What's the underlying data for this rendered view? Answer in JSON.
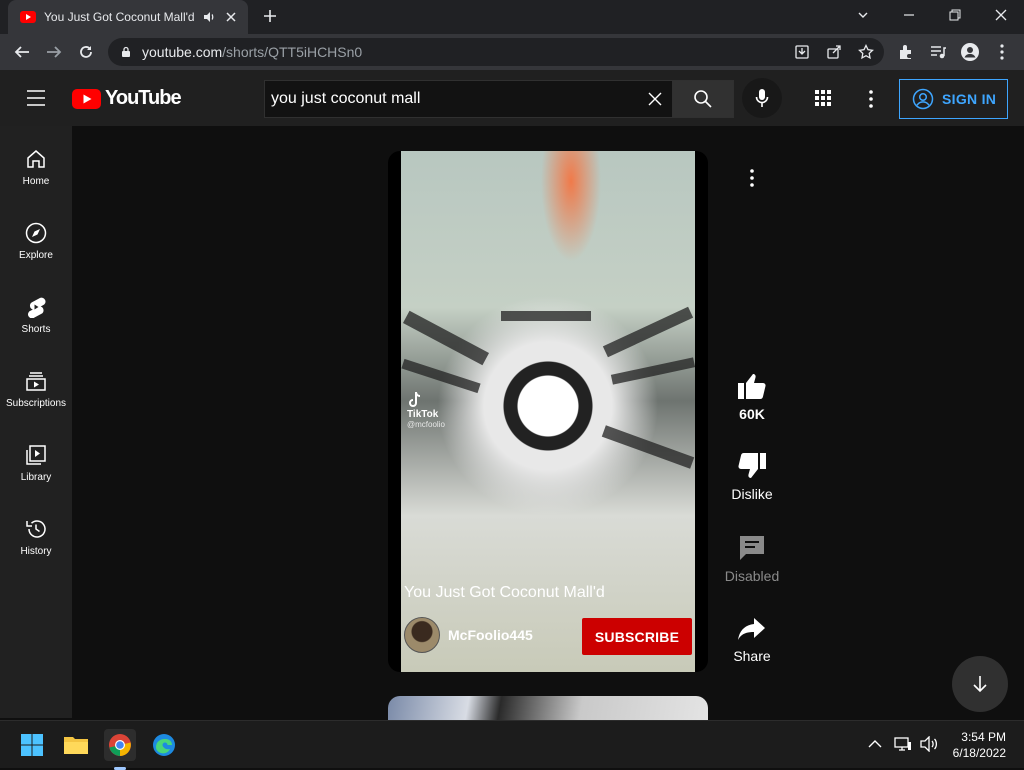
{
  "browser": {
    "tab_title": "You Just Got Coconut Mall'd",
    "url_host": "youtube.com",
    "url_path": "/shorts/QTT5iHCHSn0"
  },
  "youtube": {
    "logo_text": "YouTube",
    "search_value": "you just coconut mall",
    "sign_in_label": "SIGN IN"
  },
  "sidebar": {
    "items": [
      {
        "label": "Home",
        "icon": "home-icon"
      },
      {
        "label": "Explore",
        "icon": "compass-icon"
      },
      {
        "label": "Shorts",
        "icon": "shorts-icon"
      },
      {
        "label": "Subscriptions",
        "icon": "subscriptions-icon"
      },
      {
        "label": "Library",
        "icon": "library-icon"
      },
      {
        "label": "History",
        "icon": "history-icon"
      }
    ]
  },
  "short": {
    "title": "You Just Got Coconut Mall'd",
    "channel": "McFoolio445",
    "subscribe_label": "SUBSCRIBE",
    "overlay_watermark": "TikTok",
    "overlay_handle": "@mcfoolio"
  },
  "actions": {
    "likes": "60K",
    "dislike_label": "Dislike",
    "comments_label": "Disabled",
    "share_label": "Share"
  },
  "taskbar": {
    "time": "3:54 PM",
    "date": "6/18/2022"
  },
  "colors": {
    "yt_red": "#ff0000",
    "subscribe_red": "#cc0000",
    "sign_in_blue": "#3ea6ff"
  }
}
